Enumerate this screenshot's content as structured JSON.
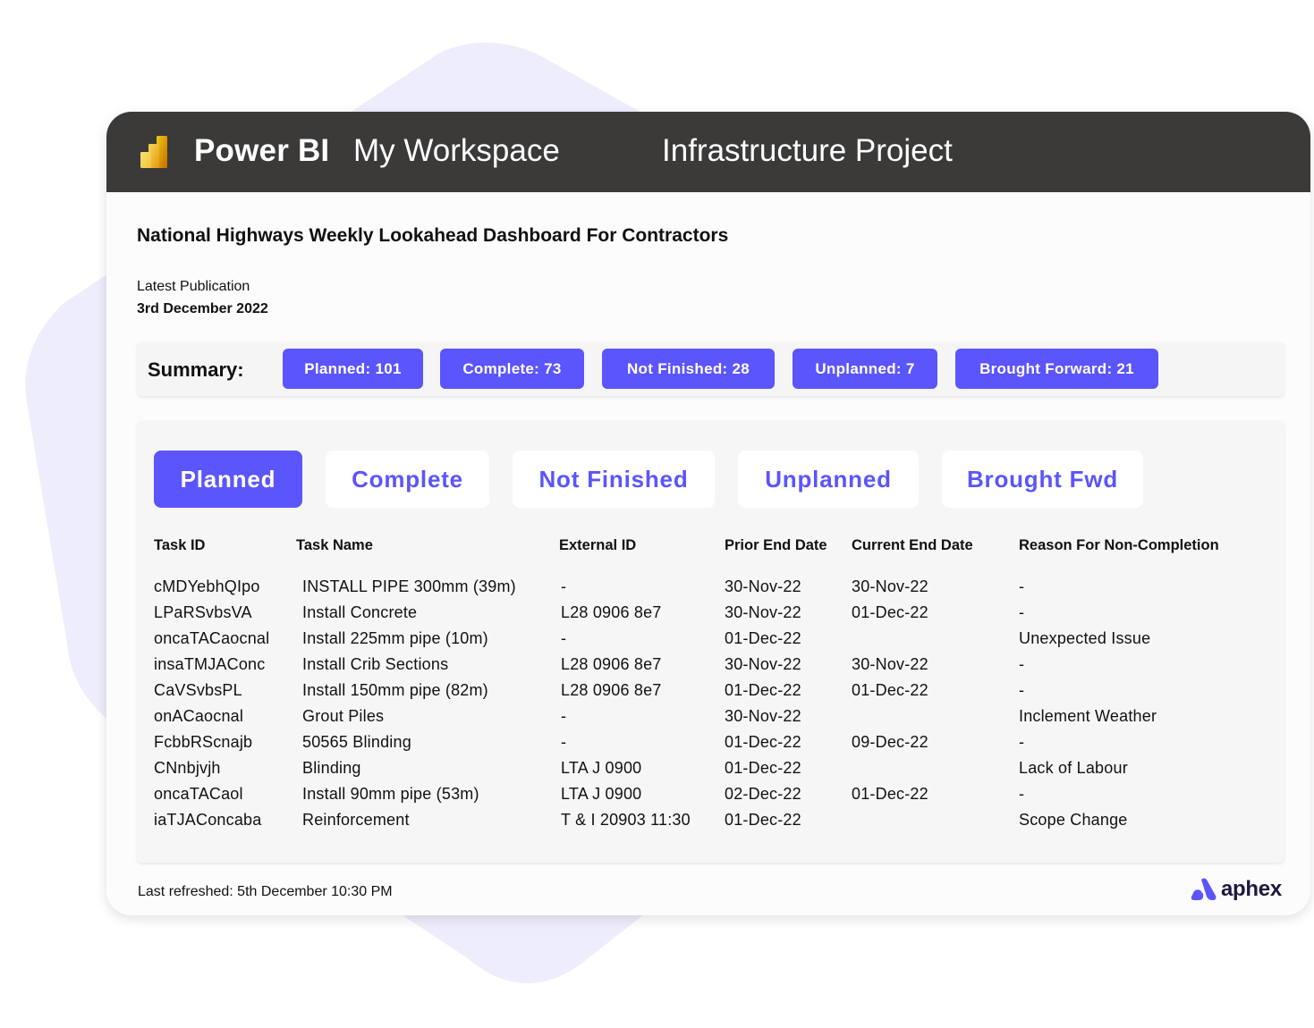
{
  "header": {
    "app_name": "Power BI",
    "workspace": "My Workspace",
    "report_name": "Infrastructure Project",
    "logo_icon": "power-bi-logo-icon"
  },
  "page": {
    "title": "National Highways Weekly Lookahead Dashboard For Contractors",
    "publication_label": "Latest Publication",
    "publication_date": "3rd December 2022"
  },
  "summary": {
    "label": "Summary:",
    "chips": [
      {
        "label": "Planned: 101",
        "name": "Planned",
        "count": 101
      },
      {
        "label": "Complete: 73",
        "name": "Complete",
        "count": 73
      },
      {
        "label": "Not Finished: 28",
        "name": "Not Finished",
        "count": 28
      },
      {
        "label": "Unplanned: 7",
        "name": "Unplanned",
        "count": 7
      },
      {
        "label": "Brought Forward: 21",
        "name": "Brought Forward",
        "count": 21
      }
    ]
  },
  "tabs": [
    {
      "label": "Planned",
      "active": true
    },
    {
      "label": "Complete",
      "active": false
    },
    {
      "label": "Not Finished",
      "active": false
    },
    {
      "label": "Unplanned",
      "active": false
    },
    {
      "label": "Brought Fwd",
      "active": false
    }
  ],
  "table": {
    "columns": [
      "Task ID",
      "Task Name",
      "External ID",
      "Prior End Date",
      "Current End Date",
      "Reason For Non-Completion"
    ],
    "rows": [
      [
        "cMDYebhQIpo",
        "INSTALL PIPE 300mm (39m)",
        "-",
        "30-Nov-22",
        "30-Nov-22",
        "-"
      ],
      [
        "LPaRSvbsVA",
        "Install Concrete",
        "L28 0906 8e7",
        "30-Nov-22",
        "01-Dec-22",
        "-"
      ],
      [
        "oncaTACaocnal",
        "Install 225mm pipe (10m)",
        "-",
        "01-Dec-22",
        "",
        "Unexpected Issue"
      ],
      [
        "insaTMJAConc",
        "Install Crib Sections",
        "L28 0906 8e7",
        "30-Nov-22",
        "30-Nov-22",
        "-"
      ],
      [
        "CaVSvbsPL",
        "Install 150mm pipe (82m)",
        "L28 0906 8e7",
        "01-Dec-22",
        "01-Dec-22",
        "-"
      ],
      [
        "onACaocnal",
        "Grout Piles",
        "-",
        "30-Nov-22",
        "",
        "Inclement Weather"
      ],
      [
        "FcbbRScnajb",
        "50565 Blinding",
        "-",
        "01-Dec-22",
        "09-Dec-22",
        "-"
      ],
      [
        "CNnbjvjh",
        "Blinding",
        "LTA J 0900",
        "01-Dec-22",
        "",
        "Lack of Labour"
      ],
      [
        "oncaTACaol",
        "Install 90mm pipe (53m)",
        "LTA J 0900",
        "02-Dec-22",
        "01-Dec-22",
        "-"
      ],
      [
        "iaTJAConcaba",
        "Reinforcement",
        "T & I 20903 11:30",
        "01-Dec-22",
        "",
        "Scope Change"
      ]
    ]
  },
  "footer": {
    "last_refreshed": "Last refreshed:  5th December 10:30 PM",
    "brand": "aphex",
    "brand_icon": "aphex-logo-icon"
  },
  "colors": {
    "accent": "#5b55fd",
    "titlebar": "#3b3a39",
    "background_shape": "#eeedfc",
    "brand_text": "#1c1940"
  }
}
